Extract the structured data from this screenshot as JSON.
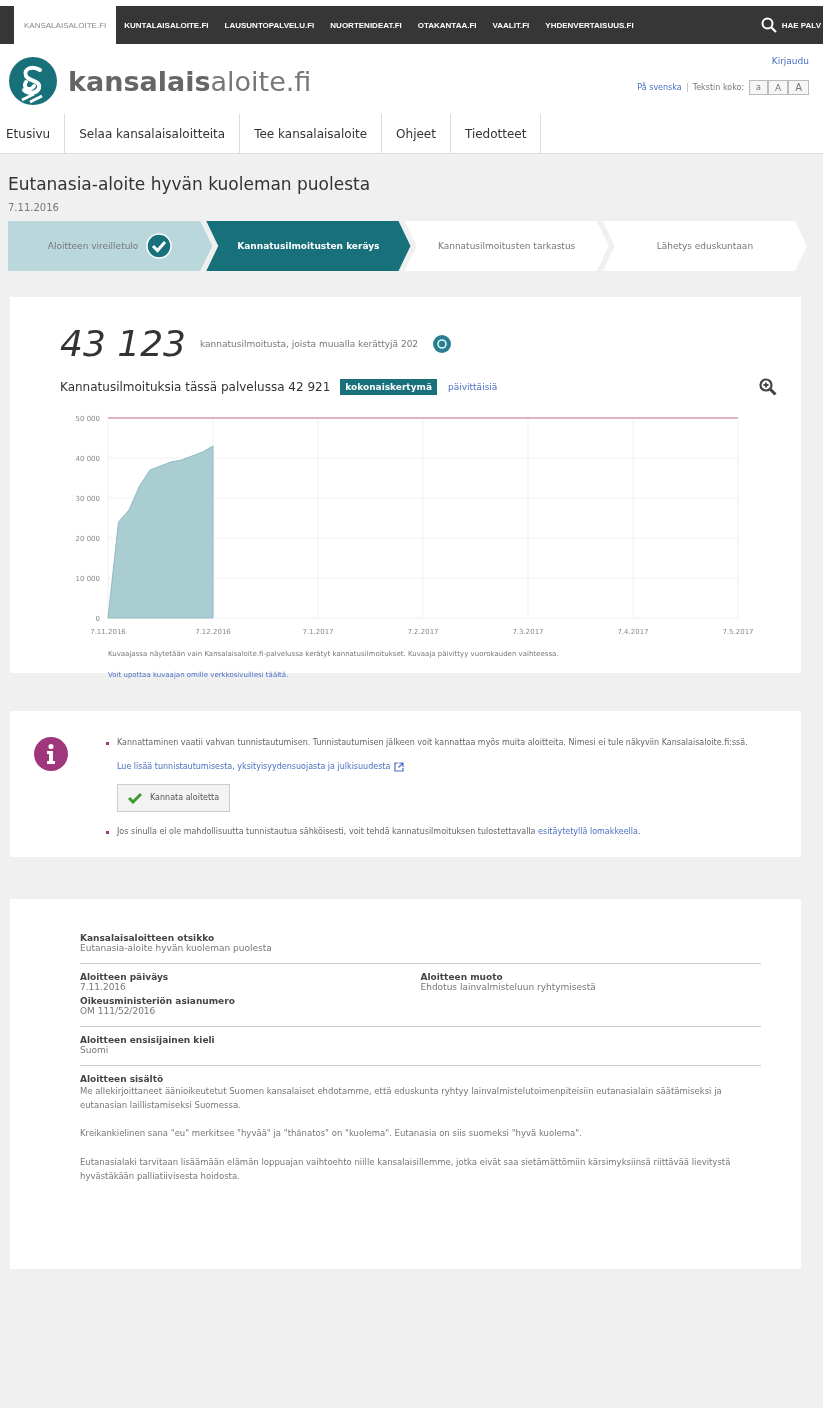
{
  "service_bar": {
    "items": [
      {
        "label": "KANSALAISALOITE.FI",
        "selected": true
      },
      {
        "label": "KUNTALAISALOITE.FI",
        "selected": false
      },
      {
        "label": "LAUSUNTOPALVELU.FI",
        "selected": false
      },
      {
        "label": "NUORTENIDEAT.FI",
        "selected": false
      },
      {
        "label": "OTAKANTAA.FI",
        "selected": false
      },
      {
        "label": "VAALIT.FI",
        "selected": false
      },
      {
        "label": "YHDENVERTAISUUS.FI",
        "selected": false
      }
    ],
    "search_label": "HAE PALV"
  },
  "header": {
    "logo_text": "**kansalais**aloite.fi",
    "login": "Kirjaudu",
    "language_link": "På svenska",
    "text_size_label": "Tekstin koko:",
    "text_size_buttons": [
      {
        "label": "a",
        "selected": false
      },
      {
        "label": "A",
        "selected": false
      },
      {
        "label": "A",
        "selected": false
      }
    ]
  },
  "nav": [
    {
      "label": "Etusivu",
      "selected": false
    },
    {
      "label": "Selaa kansalaisaloitteita",
      "selected": false
    },
    {
      "label": "Tee kansalaisaloite",
      "selected": false
    },
    {
      "label": "Ohjeet",
      "selected": false
    },
    {
      "label": "Tiedotteet",
      "selected": false
    }
  ],
  "initiative": {
    "title": "Eutanasia-aloite hyvän kuoleman puolesta",
    "date": "7.11.2016"
  },
  "steps": [
    {
      "label": "Aloitteen vireilletulo",
      "completed": true,
      "selected": false
    },
    {
      "label": "Kannatusilmoitusten keräys",
      "completed": false,
      "selected": true
    },
    {
      "label": "Kannatusilmoitusten tarkastus",
      "completed": false,
      "selected": false
    },
    {
      "label": "Lähetys eduskuntaan",
      "completed": false,
      "selected": false
    }
  ],
  "support": {
    "total": "43 123",
    "total_text": "kannatusilmoitusta, joista muualla kerättyjä 202",
    "service_count": "Kannatusilmoituksia tässä palvelussa 42 921",
    "toggles": [
      {
        "label": "kokonaiskertymä",
        "selected": true
      },
      {
        "label": "päivittäisiä",
        "selected": false
      }
    ],
    "chart_data": {
      "type": "area",
      "categories": [
        "7.11.2016",
        null,
        null,
        null,
        null,
        null,
        null,
        null,
        null,
        null,
        "7.12.2016",
        null,
        null,
        null,
        null,
        null,
        null,
        null,
        null,
        null,
        "7.1.2017",
        null,
        null,
        null,
        null,
        null,
        null,
        null,
        null,
        null,
        "7.2.2017",
        null,
        null,
        null,
        null,
        null,
        null,
        null,
        null,
        null,
        "7.3.2017",
        null,
        null,
        null,
        null,
        null,
        null,
        null,
        null,
        null,
        "7.4.2017",
        null,
        null,
        null,
        null,
        null,
        null,
        null,
        null,
        null,
        "7.5.2017"
      ],
      "values": [
        0,
        24000,
        27000,
        33000,
        37000,
        38000,
        39000,
        39500,
        40500,
        41500,
        43000,
        null,
        null,
        null,
        null,
        null,
        null,
        null,
        null,
        null,
        null,
        null,
        null,
        null,
        null,
        null,
        null,
        null,
        null,
        null,
        null,
        null,
        null,
        null,
        null,
        null,
        null,
        null,
        null,
        null,
        null,
        null,
        null,
        null,
        null,
        null,
        null,
        null,
        null,
        null,
        null,
        null,
        null,
        null,
        null,
        null,
        null,
        null,
        null,
        null,
        null
      ],
      "ylim": [
        0,
        50000
      ],
      "grid": true,
      "yticks": [
        {
          "value": 0,
          "label": "0"
        },
        {
          "value": 10000,
          "label": "10 000"
        },
        {
          "value": 20000,
          "label": "20 000"
        },
        {
          "value": 30000,
          "label": "30 000"
        },
        {
          "value": 40000,
          "label": "40 000"
        },
        {
          "value": 50000,
          "label": "50 000"
        }
      ]
    },
    "note": "Kuvaajassa näytetään vain Kansalaisaloite.fi-palvelussa kerätyt kannatusilmoitukset. Kuvaaja päivittyy vuorokauden vaihteessa.",
    "embed_link": "Voit upottaa kuvaajan omille verkkosivuillesi täältä."
  },
  "support_info": {
    "text": "Kannattaminen vaatii vahvan tunnistautumisen. Tunnistautumisen jälkeen voit kannattaa myös muita aloitteita. Nimesi ei tule näkyviin Kansalaisaloite.fi:ssä.",
    "read_more": "Lue lisää tunnistautumisesta, yksityisyydensuojasta ja julkisuudesta",
    "button": "Kannata aloitetta",
    "paper_text": "Jos sinulla ei ole mahdollisuutta tunnistautua sähköisesti, voit tehdä kannatusilmoituksen tulostettavalla",
    "paper_link": "esitäytetyllä lomakkeella",
    "paper_end": "."
  },
  "details": {
    "rows": [
      [
        {
          "label": "Kansalaisaloitteen otsikko",
          "value": "Eutanasia-aloite hyvän kuoleman puolesta"
        }
      ],
      [
        {
          "label": "Aloitteen päiväys",
          "value": "7.11.2016"
        },
        {
          "label": "Aloitteen muoto",
          "value": "Ehdotus lainvalmisteluun ryhtymisestä"
        },
        {
          "label": "Oikeusministeriön asianumero",
          "value": "OM 111/52/2016"
        }
      ],
      [
        {
          "label": "Aloitteen ensisijainen kieli",
          "value": "Suomi"
        }
      ]
    ],
    "content_label": "Aloitteen sisältö",
    "paragraphs": [
      "Me allekirjoittaneet äänioikeutetut Suomen kansalaiset ehdotamme, että eduskunta ryhtyy lainvalmistelutoimenpiteisiin eutanasialain säätämiseksi ja eutanasian laillistamiseksi Suomessa.",
      "Kreikankielinen sana \"eu\" merkitsee \"hyvää\" ja \"thánatos\" on \"kuolema\". Eutanasia on siis suomeksi \"hyvä kuolema\".",
      "Eutanasialaki tarvitaan lisäämään elämän loppuajan vaihtoehto niille kansalaisillemme, jotka eivät saa sietämättömiin kärsimyksiinsä riittävää lievitystä hyvästäkään palliatiivisesta hoidosta."
    ]
  }
}
